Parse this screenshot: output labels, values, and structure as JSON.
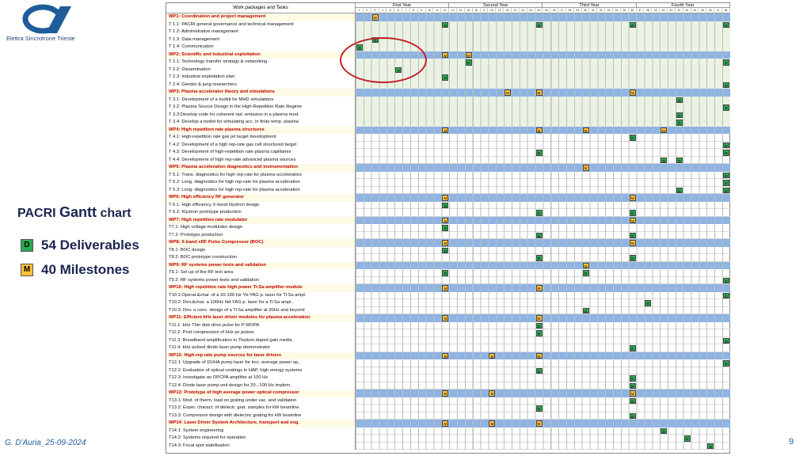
{
  "logo": {
    "text": "Elettra Sincrotrone Trieste",
    "color": "#1f5c9a"
  },
  "left_panel": {
    "title_a": "PACRI",
    "title_b": "Gantt",
    "title_c": "chart",
    "deliverables_tag": "D",
    "deliverables_label": "54 Deliverables",
    "milestones_tag": "M",
    "milestones_label": "40 Milestones"
  },
  "footer": {
    "author": "G. D'Auria_25-09-2024",
    "page": "9"
  },
  "colors": {
    "wp_bar": "#8eb4e3",
    "deliverable": "#2aa84f",
    "milestone": "#ffbf3a",
    "wp_text": "#c00000",
    "highlight": "#c32026"
  },
  "gantt": {
    "header_title": "Work packages and Tasks",
    "years": [
      "First Year",
      "Second Year",
      "Third Year",
      "Fourth Year"
    ],
    "months": [
      "1",
      "2",
      "3",
      "4",
      "5",
      "6",
      "7",
      "8",
      "9",
      "10",
      "11",
      "12",
      "13",
      "14",
      "15",
      "16",
      "17",
      "18",
      "19",
      "20",
      "21",
      "22",
      "23",
      "24",
      "25",
      "26",
      "27",
      "28",
      "29",
      "30",
      "31",
      "32",
      "33",
      "34",
      "35",
      "36",
      "37",
      "38",
      "39",
      "40",
      "41",
      "42",
      "43",
      "44",
      "45",
      "46",
      "47",
      "48"
    ],
    "rows": [
      {
        "label": "WP1: Coordination and project management",
        "wp": true,
        "marks": [
          [
            3,
            "M"
          ]
        ]
      },
      {
        "label": "T 1.1: PACRI general governance and technical management",
        "wp": false,
        "marks": [
          [
            12,
            "D"
          ],
          [
            24,
            "D"
          ],
          [
            36,
            "D"
          ],
          [
            48,
            "D"
          ]
        ]
      },
      {
        "label": "T 1.2: Administrative management",
        "wp": false,
        "marks": []
      },
      {
        "label": "T 1.3: Data management",
        "wp": false,
        "marks": [
          [
            3,
            "D"
          ]
        ]
      },
      {
        "label": "T 1.4: Communication",
        "wp": false,
        "marks": [
          [
            1,
            "D"
          ]
        ]
      },
      {
        "label": "WP2: Scientific and industrial exploitation",
        "wp": true,
        "marks": [
          [
            12,
            "M"
          ],
          [
            15,
            "M"
          ]
        ]
      },
      {
        "label": "T 2.1: Technology transfer strategy & networking",
        "wp": false,
        "marks": [
          [
            15,
            "D"
          ],
          [
            48,
            "D"
          ]
        ]
      },
      {
        "label": "T 2.2: Dissemination",
        "wp": false,
        "marks": [
          [
            6,
            "D"
          ]
        ]
      },
      {
        "label": "T 2.3: Industrial exploitation plan",
        "wp": false,
        "marks": [
          [
            12,
            "D"
          ]
        ]
      },
      {
        "label": "T 2.4: Gender & jung researchers",
        "wp": false,
        "marks": [
          [
            48,
            "D"
          ]
        ]
      },
      {
        "label": "WP3: Plasma accelerator theory and simulations",
        "wp": true,
        "marks": [
          [
            20,
            "M"
          ],
          [
            24,
            "M"
          ],
          [
            36,
            "M"
          ]
        ]
      },
      {
        "label": "T 3.1: Development of a toolkit for MHD simulations",
        "wp": false,
        "marks": [
          [
            42,
            "D"
          ]
        ]
      },
      {
        "label": "T 3.2: Plasma Source Design in the High-Repetition Rate Regime",
        "wp": false,
        "marks": [
          [
            48,
            "D"
          ]
        ]
      },
      {
        "label": "T 3.3:Develop code for coherent rad. emission in a plasma mod.",
        "wp": false,
        "marks": [
          [
            42,
            "D"
          ]
        ]
      },
      {
        "label": "T 3.4: Develop a toolkit for simulating acc. in finite temp. plasma",
        "wp": false,
        "marks": [
          [
            42,
            "D"
          ]
        ]
      },
      {
        "label": "WP4: High repetition rate plasma structures",
        "wp": true,
        "marks": [
          [
            12,
            "M"
          ],
          [
            24,
            "M"
          ],
          [
            30,
            "M"
          ],
          [
            40,
            "M"
          ]
        ]
      },
      {
        "label": "T 4.1: High-repetition rate gas jet target development",
        "wp": false,
        "marks": [
          [
            36,
            "D"
          ]
        ]
      },
      {
        "label": "T 4.2: Development of a high rep-rate gas cell structured target",
        "wp": false,
        "marks": [
          [
            48,
            "D"
          ]
        ]
      },
      {
        "label": "T 4.3: Development of high-repetition rate plasma capillaries",
        "wp": false,
        "marks": [
          [
            24,
            "D"
          ],
          [
            48,
            "D"
          ]
        ]
      },
      {
        "label": "T 4.4: Development of high rep-rate advanced plasma sources",
        "wp": false,
        "marks": [
          [
            40,
            "D"
          ],
          [
            42,
            "D"
          ]
        ]
      },
      {
        "label": "WP5: Plasma acceleration diagnostics and instrumentation",
        "wp": true,
        "marks": [
          [
            30,
            "M"
          ]
        ]
      },
      {
        "label": "T 5.1: Trans. diagnostics for high rep-rate  for plasma accelerators",
        "wp": false,
        "marks": [
          [
            48,
            "D"
          ]
        ]
      },
      {
        "label": "T 5.2: Long. diagnostics for high rep-rate  for plasma acceleration",
        "wp": false,
        "marks": [
          [
            48,
            "D"
          ]
        ]
      },
      {
        "label": "T 5.3: Long. diagnostics for high rep-rate  for plasma acceleration",
        "wp": false,
        "marks": [
          [
            42,
            "D"
          ],
          [
            48,
            "D"
          ]
        ]
      },
      {
        "label": "WP6: High efficiency RF generator",
        "wp": true,
        "marks": [
          [
            12,
            "M"
          ],
          [
            36,
            "M"
          ]
        ]
      },
      {
        "label": "T 6.1: High efficiency X-band klystron design",
        "wp": false,
        "marks": [
          [
            12,
            "D"
          ]
        ]
      },
      {
        "label": "T 6.2: Klystron prototype production",
        "wp": false,
        "marks": [
          [
            24,
            "D"
          ],
          [
            36,
            "D"
          ]
        ]
      },
      {
        "label": "WP7: High repetition rate modulator",
        "wp": true,
        "marks": [
          [
            12,
            "M"
          ],
          [
            36,
            "M"
          ]
        ]
      },
      {
        "label": "T7.1: High voltage modulator design",
        "wp": false,
        "marks": [
          [
            12,
            "D"
          ]
        ]
      },
      {
        "label": "T7.2: Prototype production",
        "wp": false,
        "marks": [
          [
            24,
            "D"
          ],
          [
            36,
            "D"
          ]
        ]
      },
      {
        "label": "WP8: X-band xRF Pulse Compressor (BOC)",
        "wp": true,
        "marks": [
          [
            12,
            "M"
          ],
          [
            36,
            "M"
          ]
        ]
      },
      {
        "label": "T8.1: BOC design",
        "wp": false,
        "marks": [
          [
            12,
            "D"
          ]
        ]
      },
      {
        "label": "T8.2: BOC prototype construction",
        "wp": false,
        "marks": [
          [
            24,
            "D"
          ],
          [
            36,
            "D"
          ]
        ]
      },
      {
        "label": "WP9: RF systems power tests and validation",
        "wp": true,
        "marks": [
          [
            30,
            "M"
          ]
        ]
      },
      {
        "label": "T9.1: Set up of the RF test area",
        "wp": false,
        "marks": [
          [
            12,
            "D"
          ],
          [
            30,
            "D"
          ]
        ]
      },
      {
        "label": "T9.2: RF systems power tests and validation",
        "wp": false,
        "marks": [
          [
            48,
            "D"
          ]
        ]
      },
      {
        "label": "WP10: High repetition rate high power Ti:Sa amplifier module",
        "wp": true,
        "marks": [
          [
            12,
            "M"
          ],
          [
            24,
            "M"
          ]
        ]
      },
      {
        "label": "T10.1:Operat.&char. of a 20-100 Hz Yb:YAG p. laser for Ti:Sa ampl.",
        "wp": false,
        "marks": [
          [
            48,
            "D"
          ]
        ]
      },
      {
        "label": "T10.2: Dev.&char. a 100Hz Nd:YAG p. laser for a Ti:Sa ampl..",
        "wp": false,
        "marks": [
          [
            38,
            "D"
          ]
        ]
      },
      {
        "label": "T10.3: Dev. a conc. design of a Ti:Sa amplifier at 20Hz and beyond",
        "wp": false,
        "marks": [
          [
            30,
            "D"
          ]
        ]
      },
      {
        "label": "WP11: Efficient kHz laser driver modules for plasma acceleration",
        "wp": true,
        "marks": [
          [
            12,
            "M"
          ],
          [
            24,
            "M"
          ]
        ]
      },
      {
        "label": "T11.1: kHz Thin disk drive pulse for P-MOPA",
        "wp": false,
        "marks": [
          [
            24,
            "D"
          ]
        ]
      },
      {
        "label": "T11.2: Post compression of kHz ps pulses",
        "wp": false,
        "marks": [
          [
            24,
            "D"
          ]
        ]
      },
      {
        "label": "T11.3: Broadband amplification in Thulium doped gain media",
        "wp": false,
        "marks": [
          [
            48,
            "D"
          ]
        ]
      },
      {
        "label": "T11.4: kHz pulsed diode laser pump demonstrator",
        "wp": false,
        "marks": [
          [
            36,
            "D"
          ]
        ]
      },
      {
        "label": "WP12: High-rep rate pump sources for laser drivers",
        "wp": true,
        "marks": [
          [
            12,
            "M"
          ],
          [
            18,
            "M"
          ],
          [
            24,
            "M"
          ]
        ]
      },
      {
        "label": "T12.1: Upgrade of DUHA pump laser for incr. average power op..",
        "wp": false,
        "marks": [
          [
            48,
            "D"
          ]
        ]
      },
      {
        "label": "T12.2: Evaluation of optical coatings in HAP, high energy systems",
        "wp": false,
        "marks": [
          [
            24,
            "D"
          ]
        ]
      },
      {
        "label": "T12.3: Investigate an OPCPA amplifier at 100 Hz",
        "wp": false,
        "marks": [
          [
            36,
            "D"
          ]
        ]
      },
      {
        "label": "T12.4: Diode laser pump unit design for 20...100 Hz implem.",
        "wp": false,
        "marks": [
          [
            36,
            "D"
          ]
        ]
      },
      {
        "label": "WP13: Prototype of high average power optical compressor",
        "wp": true,
        "marks": [
          [
            12,
            "M"
          ],
          [
            18,
            "M"
          ],
          [
            36,
            "M"
          ]
        ]
      },
      {
        "label": "T13.1: Mod. of therm. load on grating under vac. and validation",
        "wp": false,
        "marks": [
          [
            36,
            "D"
          ]
        ]
      },
      {
        "label": "T13.2: Exper. charact. of dielectr. grat. samples for kW beamline",
        "wp": false,
        "marks": [
          [
            24,
            "D"
          ]
        ]
      },
      {
        "label": "T13.3: Compressor design with dielectric grating for kW beamline",
        "wp": false,
        "marks": [
          [
            36,
            "D"
          ]
        ]
      },
      {
        "label": "WP14: Laser Driver System Architecture, transport and eng.",
        "wp": true,
        "marks": [
          [
            12,
            "M"
          ],
          [
            18,
            "M"
          ],
          [
            24,
            "M"
          ]
        ]
      },
      {
        "label": "T14.1: System engineering",
        "wp": false,
        "marks": [
          [
            40,
            "D"
          ]
        ]
      },
      {
        "label": "T14.2: Systems required for operation",
        "wp": false,
        "marks": [
          [
            43,
            "D"
          ]
        ]
      },
      {
        "label": "T14.3: Focal spot stabilisation",
        "wp": false,
        "marks": [
          [
            46,
            "D"
          ]
        ]
      }
    ]
  }
}
